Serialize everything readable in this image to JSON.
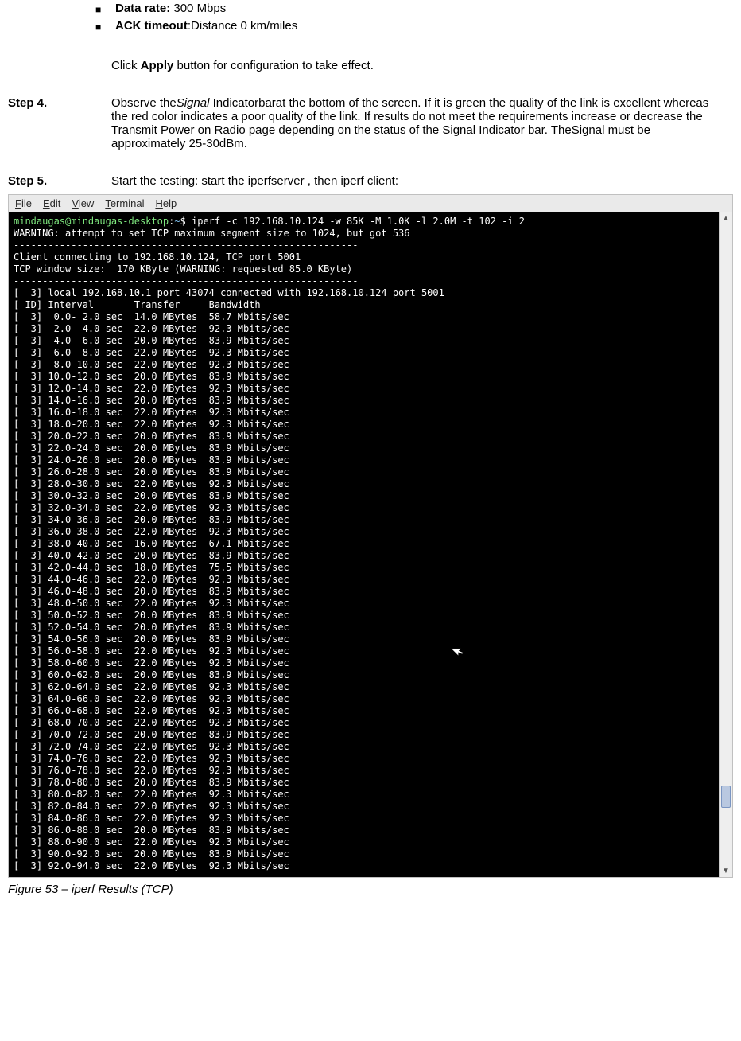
{
  "bullets": {
    "data_rate_label": "Data rate:",
    "data_rate_value": " 300 Mbps",
    "ack_label": "ACK timeout",
    "ack_value": ":Distance 0 km/miles"
  },
  "apply_line_prefix": "Click ",
  "apply_line_bold": "Apply",
  "apply_line_suffix": " button for configuration to take effect.",
  "step4": {
    "label": "Step 4.",
    "pre": "Observe the",
    "signal": "Signal",
    "rest": " Indicatorbarat the bottom of the screen. If it is green the quality of the link is excellent whereas the red color indicates a poor quality of the link. If results do not meet the requirements increase or decrease the Transmit Power on Radio page depending on the status of the Signal Indicator  bar. TheSignal must be approximately 25-30dBm."
  },
  "step5": {
    "label": "Step 5.",
    "text": "Start the testing: start the iperfserver , then iperf client:"
  },
  "menu": {
    "file": "File",
    "edit": "Edit",
    "view": "View",
    "terminal": "Terminal",
    "help": "Help"
  },
  "terminal": {
    "prompt_user": "mindaugas@mindaugas-desktop",
    "prompt_sep": ":",
    "prompt_path": "~",
    "prompt_end": "$ ",
    "cmd": "iperf -c 192.168.10.124 -w 85K -M 1.0K -l 2.0M -t 102 -i 2",
    "warning": "WARNING: attempt to set TCP maximum segment size to 1024, but got 536",
    "dash": "------------------------------------------------------------",
    "connecting": "Client connecting to 192.168.10.124, TCP port 5001",
    "window": "TCP window size:  170 KByte (WARNING: requested 85.0 KByte)",
    "local": "[  3] local 192.168.10.1 port 43074 connected with 192.168.10.124 port 5001",
    "header": "[ ID] Interval       Transfer     Bandwidth",
    "rows": [
      {
        "a": " 0.0- 2.0",
        "t": "14.0",
        "b": "58.7"
      },
      {
        "a": " 2.0- 4.0",
        "t": "22.0",
        "b": "92.3"
      },
      {
        "a": " 4.0- 6.0",
        "t": "20.0",
        "b": "83.9"
      },
      {
        "a": " 6.0- 8.0",
        "t": "22.0",
        "b": "92.3"
      },
      {
        "a": " 8.0-10.0",
        "t": "22.0",
        "b": "92.3"
      },
      {
        "a": "10.0-12.0",
        "t": "20.0",
        "b": "83.9"
      },
      {
        "a": "12.0-14.0",
        "t": "22.0",
        "b": "92.3"
      },
      {
        "a": "14.0-16.0",
        "t": "20.0",
        "b": "83.9"
      },
      {
        "a": "16.0-18.0",
        "t": "22.0",
        "b": "92.3"
      },
      {
        "a": "18.0-20.0",
        "t": "22.0",
        "b": "92.3"
      },
      {
        "a": "20.0-22.0",
        "t": "20.0",
        "b": "83.9"
      },
      {
        "a": "22.0-24.0",
        "t": "20.0",
        "b": "83.9"
      },
      {
        "a": "24.0-26.0",
        "t": "20.0",
        "b": "83.9"
      },
      {
        "a": "26.0-28.0",
        "t": "20.0",
        "b": "83.9"
      },
      {
        "a": "28.0-30.0",
        "t": "22.0",
        "b": "92.3"
      },
      {
        "a": "30.0-32.0",
        "t": "20.0",
        "b": "83.9"
      },
      {
        "a": "32.0-34.0",
        "t": "22.0",
        "b": "92.3"
      },
      {
        "a": "34.0-36.0",
        "t": "20.0",
        "b": "83.9"
      },
      {
        "a": "36.0-38.0",
        "t": "22.0",
        "b": "92.3"
      },
      {
        "a": "38.0-40.0",
        "t": "16.0",
        "b": "67.1"
      },
      {
        "a": "40.0-42.0",
        "t": "20.0",
        "b": "83.9"
      },
      {
        "a": "42.0-44.0",
        "t": "18.0",
        "b": "75.5"
      },
      {
        "a": "44.0-46.0",
        "t": "22.0",
        "b": "92.3"
      },
      {
        "a": "46.0-48.0",
        "t": "20.0",
        "b": "83.9"
      },
      {
        "a": "48.0-50.0",
        "t": "22.0",
        "b": "92.3"
      },
      {
        "a": "50.0-52.0",
        "t": "20.0",
        "b": "83.9"
      },
      {
        "a": "52.0-54.0",
        "t": "20.0",
        "b": "83.9"
      },
      {
        "a": "54.0-56.0",
        "t": "20.0",
        "b": "83.9"
      },
      {
        "a": "56.0-58.0",
        "t": "22.0",
        "b": "92.3"
      },
      {
        "a": "58.0-60.0",
        "t": "22.0",
        "b": "92.3"
      },
      {
        "a": "60.0-62.0",
        "t": "20.0",
        "b": "83.9"
      },
      {
        "a": "62.0-64.0",
        "t": "22.0",
        "b": "92.3"
      },
      {
        "a": "64.0-66.0",
        "t": "22.0",
        "b": "92.3"
      },
      {
        "a": "66.0-68.0",
        "t": "22.0",
        "b": "92.3"
      },
      {
        "a": "68.0-70.0",
        "t": "22.0",
        "b": "92.3"
      },
      {
        "a": "70.0-72.0",
        "t": "20.0",
        "b": "83.9"
      },
      {
        "a": "72.0-74.0",
        "t": "22.0",
        "b": "92.3"
      },
      {
        "a": "74.0-76.0",
        "t": "22.0",
        "b": "92.3"
      },
      {
        "a": "76.0-78.0",
        "t": "22.0",
        "b": "92.3"
      },
      {
        "a": "78.0-80.0",
        "t": "20.0",
        "b": "83.9"
      },
      {
        "a": "80.0-82.0",
        "t": "22.0",
        "b": "92.3"
      },
      {
        "a": "82.0-84.0",
        "t": "22.0",
        "b": "92.3"
      },
      {
        "a": "84.0-86.0",
        "t": "22.0",
        "b": "92.3"
      },
      {
        "a": "86.0-88.0",
        "t": "20.0",
        "b": "83.9"
      },
      {
        "a": "88.0-90.0",
        "t": "22.0",
        "b": "92.3"
      },
      {
        "a": "90.0-92.0",
        "t": "20.0",
        "b": "83.9"
      },
      {
        "a": "92.0-94.0",
        "t": "22.0",
        "b": "92.3"
      }
    ]
  },
  "figure_caption": "Figure 53 – iperf Results (TCP)"
}
